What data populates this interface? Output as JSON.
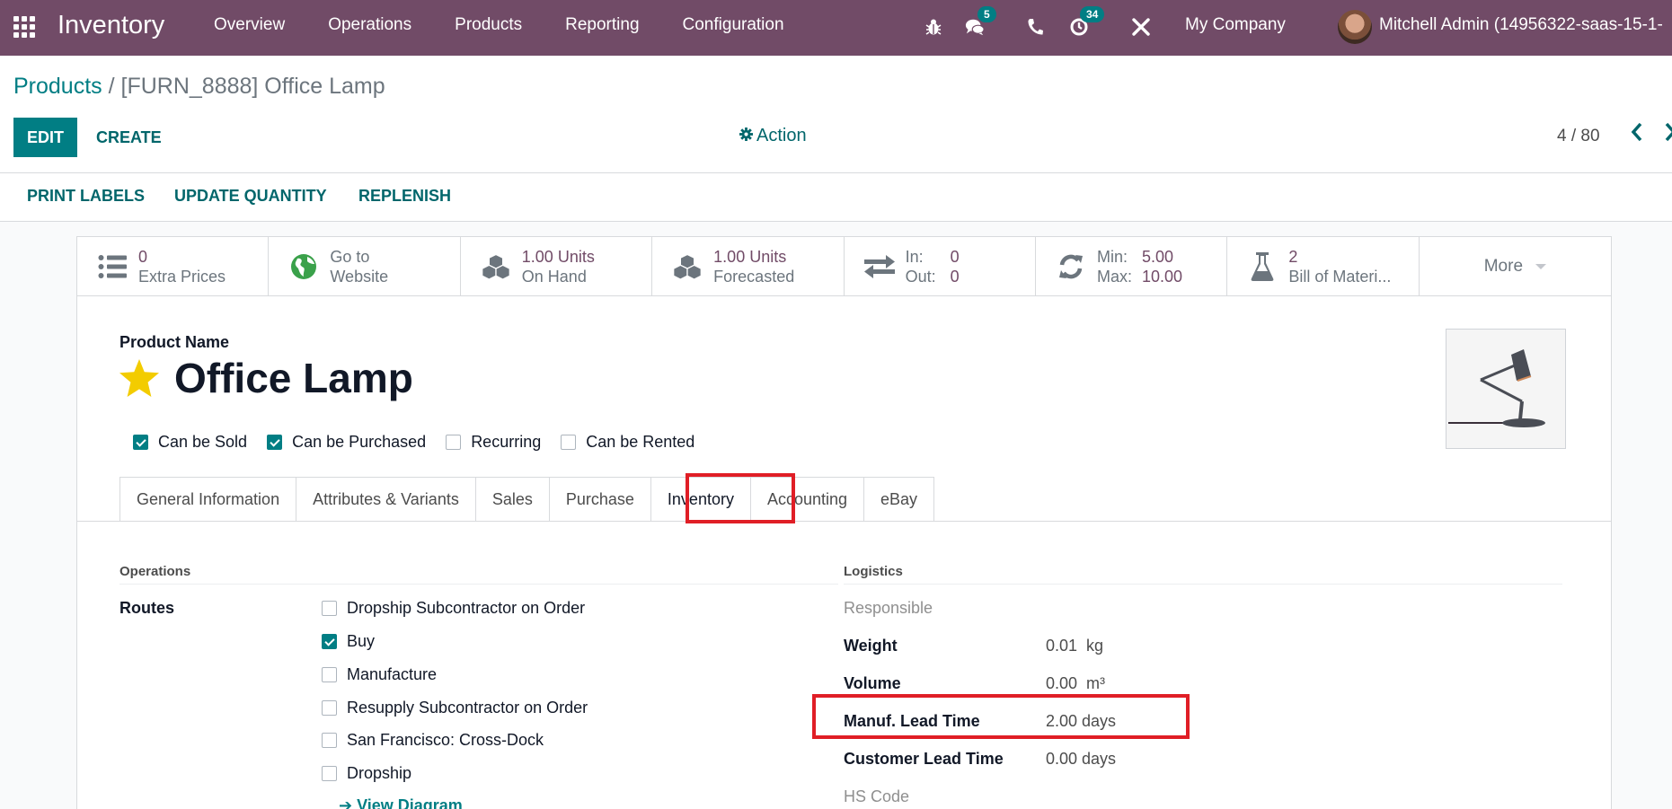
{
  "navbar": {
    "app_name": "Inventory",
    "menu": [
      "Overview",
      "Operations",
      "Products",
      "Reporting",
      "Configuration"
    ],
    "systray": {
      "debug_icon": "bug-icon",
      "messages_icon": "comments-icon",
      "messages_count": "5",
      "phone_icon": "phone-icon",
      "activities_icon": "clock-icon",
      "activities_count": "34",
      "tools_icon": "tools-icon"
    },
    "company": "My Company",
    "user": "Mitchell Admin (14956322-saas-15-1-"
  },
  "control_panel": {
    "breadcrumb_parent": "Products",
    "breadcrumb_sep": " / ",
    "breadcrumb_current": "[FURN_8888] Office Lamp",
    "edit_label": "EDIT",
    "create_label": "CREATE",
    "action_label": "Action",
    "pager": "4 / 80",
    "prev": "‹",
    "next": "›"
  },
  "statusbar": {
    "buttons": [
      "PRINT LABELS",
      "UPDATE QUANTITY",
      "REPLENISH"
    ]
  },
  "smart_buttons": [
    {
      "icon": "list-icon",
      "value": "0",
      "label": "Extra Prices"
    },
    {
      "icon": "globe-icon",
      "value": "Go to",
      "label": "Website"
    },
    {
      "icon": "cubes-icon",
      "value": "1.00 Units",
      "label": "On Hand"
    },
    {
      "icon": "cubes-icon",
      "value": "1.00 Units",
      "label": "Forecasted"
    },
    {
      "icon": "exchange-icon",
      "k1": "In:",
      "v1": "0",
      "k2": "Out:",
      "v2": "0"
    },
    {
      "icon": "refresh-icon",
      "k1": "Min:",
      "v1": "5.00",
      "k2": "Max:",
      "v2": "10.00"
    },
    {
      "icon": "flask-icon",
      "value": "2",
      "label": "Bill of Materi..."
    },
    {
      "label": "More"
    }
  ],
  "product": {
    "name_label": "Product Name",
    "name": "Office Lamp",
    "favorite": true,
    "flags": [
      {
        "label": "Can be Sold",
        "checked": true
      },
      {
        "label": "Can be Purchased",
        "checked": true
      },
      {
        "label": "Recurring",
        "checked": false
      },
      {
        "label": "Can be Rented",
        "checked": false
      }
    ]
  },
  "tabs": [
    "General Information",
    "Attributes & Variants",
    "Sales",
    "Purchase",
    "Inventory",
    "Accounting",
    "eBay"
  ],
  "active_tab": "Inventory",
  "operations": {
    "title": "Operations",
    "routes_label": "Routes",
    "routes": [
      {
        "label": "Dropship Subcontractor on Order",
        "checked": false
      },
      {
        "label": "Buy",
        "checked": true
      },
      {
        "label": "Manufacture",
        "checked": false
      },
      {
        "label": "Resupply Subcontractor on Order",
        "checked": false
      },
      {
        "label": "San Francisco: Cross-Dock",
        "checked": false
      },
      {
        "label": "Dropship",
        "checked": false
      }
    ],
    "view_diagram": "➔ View Diagram"
  },
  "logistics": {
    "title": "Logistics",
    "responsible_label": "Responsible",
    "weight_label": "Weight",
    "weight_value": "0.01  kg",
    "volume_label": "Volume",
    "volume_value": "0.00  m³",
    "manuf_lead_label": "Manuf. Lead Time",
    "manuf_lead_value": "2.00 days",
    "customer_lead_label": "Customer Lead Time",
    "customer_lead_value": "0.00 days",
    "hs_code_label": "HS Code"
  },
  "colors": {
    "brand": "#714b67",
    "primary": "#017e84",
    "highlight": "#e01e26",
    "star": "#f3cc00"
  }
}
